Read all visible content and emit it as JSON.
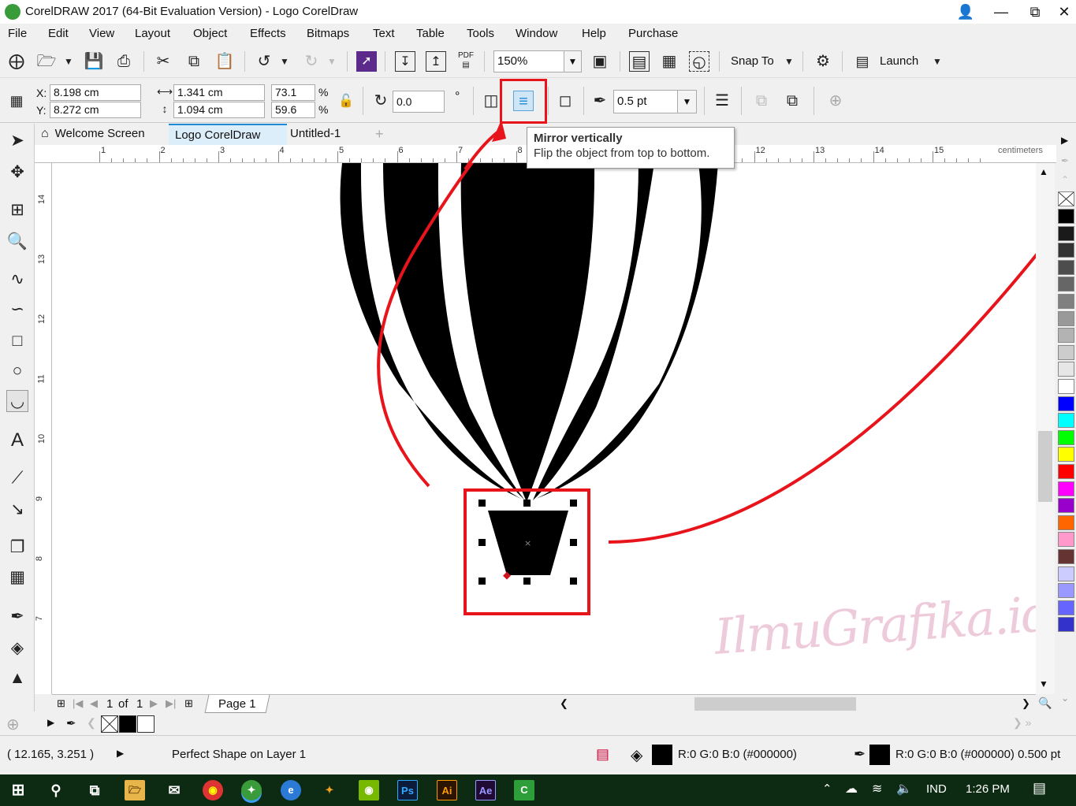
{
  "window": {
    "title": "CorelDRAW 2017 (64-Bit Evaluation Version) - Logo CorelDraw"
  },
  "menu": [
    "File",
    "Edit",
    "View",
    "Layout",
    "Object",
    "Effects",
    "Bitmaps",
    "Text",
    "Table",
    "Tools",
    "Window",
    "Help",
    "Purchase"
  ],
  "toolbar": {
    "zoom": "150%",
    "pdf_label": "PDF",
    "snap_label": "Snap To",
    "launch_label": "Launch"
  },
  "property_bar": {
    "x_label": "X:",
    "y_label": "Y:",
    "x_value": "8.198 cm",
    "y_value": "8.272 cm",
    "width_value": "1.341 cm",
    "height_value": "1.094 cm",
    "scale_w": "73.1",
    "scale_h": "59.6",
    "percent": "%",
    "rotation": "0.0",
    "degree": "°",
    "outline_width": "0.5 pt"
  },
  "tooltip": {
    "title": "Mirror vertically",
    "description": "Flip the object from top to bottom."
  },
  "tabs": [
    {
      "label": "Welcome Screen"
    },
    {
      "label": "Logo CorelDraw"
    },
    {
      "label": "Untitled-1"
    }
  ],
  "ruler": {
    "unit": "centimeters",
    "h_numbers": [
      "1",
      "2",
      "3",
      "4",
      "5",
      "6",
      "7",
      "8",
      "9",
      "10",
      "11",
      "12",
      "13",
      "14",
      "15"
    ],
    "v_numbers": [
      "14",
      "13",
      "12",
      "11",
      "10",
      "9",
      "8",
      "7"
    ]
  },
  "page_nav": {
    "current": "1",
    "of": "of",
    "total": "1",
    "page_tab": "Page 1"
  },
  "watermark": "IlmuGrafika.id",
  "status": {
    "coordinates": "( 12.165, 3.251 )",
    "object_info": "Perfect Shape on Layer 1",
    "fill_info": "R:0 G:0 B:0 (#000000)",
    "outline_info": "R:0 G:0 B:0 (#000000)  0.500 pt"
  },
  "taskbar": {
    "language": "IND",
    "time": "1:26 PM",
    "apps": [
      {
        "name": "Ps",
        "color": "#0b1d3a",
        "fg": "#31a8ff"
      },
      {
        "name": "Ai",
        "color": "#2b1400",
        "fg": "#ff9a00"
      },
      {
        "name": "Ae",
        "color": "#1f0b35",
        "fg": "#9999ff"
      }
    ]
  },
  "palette": [
    "#000000",
    "#1a1a1a",
    "#333333",
    "#4d4d4d",
    "#666666",
    "#808080",
    "#999999",
    "#b3b3b3",
    "#cccccc",
    "#e6e6e6",
    "#ffffff",
    "#0000ff",
    "#00ffff",
    "#00ff00",
    "#ffff00",
    "#ff0000",
    "#ff00ff",
    "#9900cc",
    "#ff6600",
    "#ff99cc",
    "#663333",
    "#ccccff",
    "#9999ff",
    "#6666ff",
    "#3333cc"
  ],
  "colors": {
    "highlight_red": "#e8141b",
    "selected_tab": "#ddeefb",
    "accent_blue": "#1e8ad6"
  }
}
